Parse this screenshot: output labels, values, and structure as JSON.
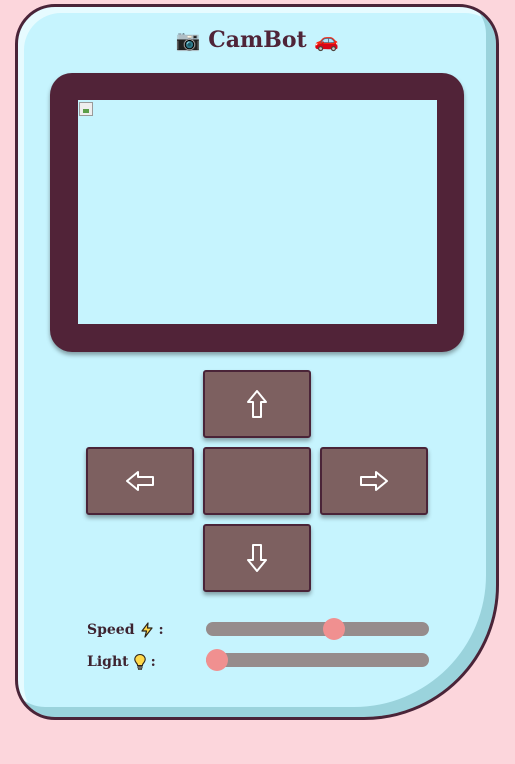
{
  "app": {
    "title": "CamBot",
    "title_left_emoji": "📷",
    "title_right_emoji": "🚗"
  },
  "camera": {
    "feed_icon": "broken-image-icon"
  },
  "controls": {
    "up_icon": "arrow-up-outline-icon",
    "left_icon": "arrow-left-outline-icon",
    "right_icon": "arrow-right-outline-icon",
    "down_icon": "arrow-down-outline-icon"
  },
  "speed": {
    "label": "Speed",
    "icon": "lightning-bolt-icon",
    "colon": ":",
    "value_fraction": 0.58
  },
  "light": {
    "label": "Light",
    "icon": "light-bulb-icon",
    "colon": ":",
    "value_fraction": 0.0
  },
  "colors": {
    "background": "#fcd6dc",
    "device": "#c6f4fe",
    "frame": "#512338",
    "button": "#7d6060",
    "slider_track": "#968c8c",
    "slider_thumb": "#f09090"
  }
}
